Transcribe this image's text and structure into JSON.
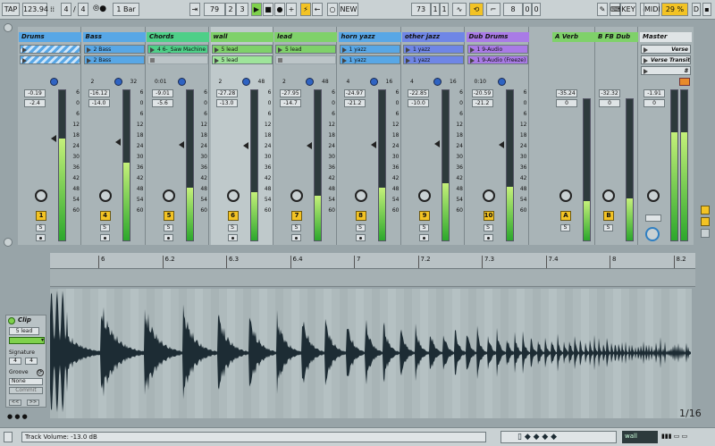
{
  "transport": {
    "tap": "TAP",
    "tempo": "123.94",
    "time_sig_num": "4",
    "time_sig_den": "4",
    "quantize": "1 Bar",
    "position": [
      "79",
      "2",
      "3"
    ],
    "new_label": "NEW",
    "loop_start": [
      "73",
      "1",
      "1"
    ],
    "loop_len": [
      "8",
      "0",
      "0"
    ],
    "key_label": "KEY",
    "midi_label": "MIDI",
    "cpu": "29 %"
  },
  "tracks": [
    {
      "name": "Drums",
      "color": "#58a7e6",
      "slots": [
        "",
        ""
      ],
      "slot_colors": [
        "#58a7e6",
        "#58a7e6"
      ],
      "vol": "-0.19",
      "peak": "-2.4",
      "level": 0.68,
      "num": "1"
    },
    {
      "name": "Bass",
      "color": "#58a7e6",
      "slots": [
        "2 Bass",
        "2 Bass"
      ],
      "slot_colors": [
        "#58a7e6",
        "#58a7e6"
      ],
      "vol": "-16.12",
      "peak": "-14.0",
      "level": 0.52,
      "num": "4",
      "io_a": "2",
      "io_b": "32"
    },
    {
      "name": "Chords",
      "color": "#4ecf88",
      "slots": [
        "4 6-_Saw Machine (F",
        ""
      ],
      "slot_colors": [
        "#4ecf88",
        ""
      ],
      "vol": "-9.01",
      "peak": "-5.6",
      "level": 0.35,
      "num": "5",
      "io_a": "0:01"
    },
    {
      "name": "wall",
      "color": "#7fd16a",
      "slots": [
        "5 lead",
        "5 lead"
      ],
      "slot_colors": [
        "#7fd16a",
        "#9ee49a"
      ],
      "vol": "-27.28",
      "peak": "-13.0",
      "level": 0.32,
      "num": "6",
      "io_a": "2",
      "io_b": "48"
    },
    {
      "name": "lead",
      "color": "#7fd16a",
      "slots": [
        "5 lead",
        ""
      ],
      "slot_colors": [
        "#7fd16a",
        ""
      ],
      "vol": "-27.95",
      "peak": "-14.7",
      "level": 0.3,
      "num": "7",
      "io_a": "2",
      "io_b": "48"
    },
    {
      "name": "horn yazz",
      "color": "#58a7e6",
      "slots": [
        "1 yazz",
        "1 yazz"
      ],
      "slot_colors": [
        "#58a7e6",
        "#58a7e6"
      ],
      "vol": "-24.97",
      "peak": "-21.2",
      "level": 0.35,
      "num": "8",
      "io_a": "4",
      "io_b": "16"
    },
    {
      "name": "other jazz",
      "color": "#6f86e6",
      "slots": [
        "1 yazz",
        "1 yazz"
      ],
      "slot_colors": [
        "#6f86e6",
        "#6f86e6"
      ],
      "vol": "-22.85",
      "peak": "-10.0",
      "level": 0.38,
      "num": "9",
      "io_a": "4",
      "io_b": "16"
    },
    {
      "name": "Dub Drums",
      "color": "#a97be6",
      "slots": [
        "1 9-Audio",
        "1 9-Audio (Freeze)"
      ],
      "slot_colors": [
        "#a97be6",
        "#a97be6"
      ],
      "vol": "-20.59",
      "peak": "-21.2",
      "level": 0.36,
      "num": "10",
      "io_a": "0:10"
    }
  ],
  "returns": [
    {
      "name": "A Verb",
      "color": "#7fd16a",
      "vol": "-35.24",
      "peak": "0",
      "level": 0.28,
      "num": "A"
    },
    {
      "name": "B FB Dub",
      "color": "#7fd16a",
      "vol": "-32.32",
      "peak": "0",
      "level": 0.3,
      "num": "B"
    }
  ],
  "master": {
    "name": "Master",
    "scenes": [
      "Verse",
      "Verse Transiti",
      "8"
    ],
    "vol": "-1.91",
    "peak": "0",
    "level": 0.72
  },
  "scale": [
    "6",
    "0",
    "6",
    "12",
    "18",
    "24",
    "30",
    "36",
    "42",
    "48",
    "54",
    "60"
  ],
  "ruler": [
    "6",
    "6.2",
    "6.3",
    "6.4",
    "7",
    "7.2",
    "7.3",
    "7.4",
    "8",
    "8.2"
  ],
  "clip": {
    "title": "Clip",
    "name": "5 lead",
    "signature_label": "Signature",
    "sig_num": "4",
    "sig_den": "4",
    "groove_label": "Groove",
    "groove_value": "None",
    "commit": "Commit"
  },
  "zoom": "1/16",
  "status": {
    "text": "Track Volume: -13.0 dB",
    "right": "wall"
  },
  "colors": {
    "accent": "#f3c324",
    "green": "#7fd14c"
  }
}
